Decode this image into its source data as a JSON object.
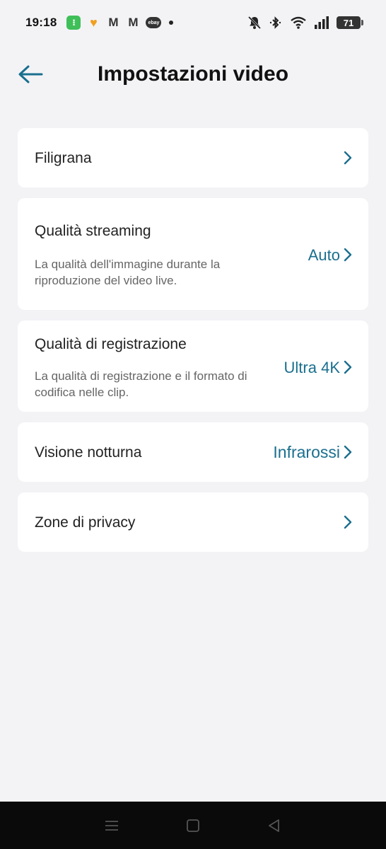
{
  "status_bar": {
    "time": "19:18",
    "battery": "71"
  },
  "header": {
    "title": "Impostazioni video"
  },
  "settings": [
    {
      "title": "Filigrana",
      "description": "",
      "value": ""
    },
    {
      "title": "Qualità streaming",
      "description": "La qualità dell'immagine durante la riproduzione del video live.",
      "value": "Auto"
    },
    {
      "title": "Qualità di registrazione",
      "description": "La qualità di registrazione e il formato di codifica nelle clip.",
      "value": "Ultra 4K"
    },
    {
      "title": "Visione notturna",
      "description": "",
      "value": "Infrarossi"
    },
    {
      "title": "Zone di privacy",
      "description": "",
      "value": ""
    }
  ],
  "colors": {
    "accent": "#1a6f8e",
    "background": "#f3f3f6",
    "card": "#ffffff"
  }
}
